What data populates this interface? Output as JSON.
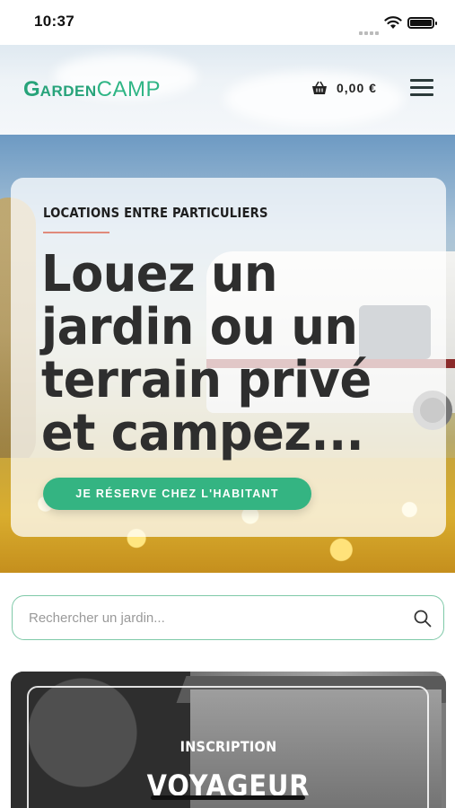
{
  "status_bar": {
    "time": "10:37"
  },
  "header": {
    "logo_g": "G",
    "logo_arden": "ARDEN",
    "logo_camp": "CAMP",
    "cart_total": "0,00 €"
  },
  "hero": {
    "eyebrow": "LOCATIONS ENTRE PARTICULIERS",
    "headline": "Louez un jardin ou un terrain privé et campez...",
    "cta_label": "JE RÉSERVE CHEZ L'HABITANT"
  },
  "search": {
    "placeholder": "Rechercher un jardin..."
  },
  "promo": {
    "kicker": "INSCRIPTION",
    "title": "VOYAGEUR"
  },
  "colors": {
    "accent": "#34b482",
    "brand": "#27a37a",
    "eyebrow_line": "#e08a7b"
  },
  "icons": [
    "wifi-icon",
    "battery-icon",
    "basket-icon",
    "hamburger-menu-icon",
    "search-icon"
  ]
}
